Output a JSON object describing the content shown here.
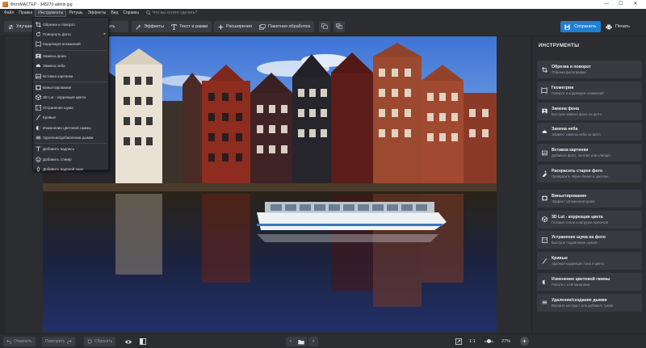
{
  "window": {
    "title": "ФотоМАСТЕР - 348270-admin.jpg",
    "controls": [
      "—",
      "☐",
      "✕"
    ]
  },
  "menubar": {
    "items": [
      "Файл",
      "Правка",
      "Инструменты",
      "Ретушь",
      "Эффекты",
      "Вид",
      "Справка"
    ],
    "active": "Инструменты",
    "search_placeholder": "Что вы хотите сделать?"
  },
  "toolbar": {
    "enhance_label": "Улучшение",
    "partial_label": "ать",
    "effects_label": "Эффекты",
    "text_label": "Текст и рамки",
    "extensions_label": "Расширения",
    "batch_label": "Пакетная обработка",
    "save_label": "Сохранить",
    "print_label": "Печать"
  },
  "tools_menu": {
    "items": [
      {
        "label": "Обрезка и поворот",
        "icon": "crop-icon"
      },
      {
        "label": "Повернуть фото",
        "icon": "rotate-icon",
        "submenu": true
      },
      {
        "label": "Коррекция искажений",
        "icon": "distortion-icon"
      },
      {
        "label": "Замена фона",
        "icon": "background-replace-icon"
      },
      {
        "label": "Замена неба",
        "icon": "sky-replace-icon"
      },
      {
        "label": "Вставка картинки",
        "icon": "insert-image-icon"
      },
      {
        "label": "Виньетирование",
        "icon": "vignette-icon"
      },
      {
        "label": "3D Lut - коррекция цвета",
        "icon": "lut-icon"
      },
      {
        "label": "Устранение шума",
        "icon": "noise-icon"
      },
      {
        "label": "Кривые",
        "icon": "curves-icon"
      },
      {
        "label": "Изменение цветовой гаммы",
        "icon": "color-gamut-icon"
      },
      {
        "label": "Удаление/добавление дымки",
        "icon": "haze-icon"
      },
      {
        "label": "Добавить надпись",
        "icon": "text-icon"
      },
      {
        "label": "Добавить стикер",
        "icon": "sticker-icon"
      },
      {
        "label": "Добавить водяной знак",
        "icon": "watermark-icon"
      }
    ]
  },
  "panel": {
    "title": "ИНСТРУМЕНТЫ",
    "cards": [
      {
        "title": "Обрезка и поворот",
        "desc": "Обрезка фотографии",
        "icon": "crop-icon"
      },
      {
        "title": "Геометрия",
        "desc": "Поворот и коррекция искажений",
        "icon": "geometry-icon"
      },
      {
        "title": "Замена фона",
        "desc": "Быстрая замена фона на фото",
        "icon": "background-replace-icon"
      },
      {
        "title": "Замена неба",
        "desc": "Эффект замены неба на фото",
        "icon": "sky-replace-icon"
      },
      {
        "title": "Вставка картинки",
        "desc": "Добавьте фото, логотип или клипарт",
        "icon": "insert-image-icon"
      },
      {
        "title": "Раскрасить старое фото",
        "desc": "Превратить чёрно-белое в цветное",
        "icon": "colorize-icon"
      },
      {
        "title": "Виньетирование",
        "desc": "Эффект затемнения краёв",
        "icon": "vignette-icon"
      },
      {
        "title": "3D Lut - коррекция цвета",
        "desc": "Готовые стили и загрузка пресетов",
        "icon": "lut-icon"
      },
      {
        "title": "Устранение шума на фото",
        "desc": "Быстрое подавление шумов",
        "icon": "noise-icon"
      },
      {
        "title": "Кривые",
        "desc": "Удобная коррекция тона и цвета",
        "icon": "curves-icon"
      },
      {
        "title": "Изменение цветовой гаммы",
        "desc": "Работа с LAB каналами",
        "icon": "color-gamut-icon"
      },
      {
        "title": "Удаление/создание дымки",
        "desc": "Верните контраст или добавьте туман",
        "icon": "haze-icon"
      }
    ]
  },
  "bottombar": {
    "undo_label": "Отменить",
    "redo_label": "Повторить",
    "reset_label": "Сбросить",
    "zoom_ratio": "1:1",
    "zoom_percent": "27%"
  },
  "colors": {
    "accent": "#1f7fd4",
    "background": "#2b2d31",
    "panel_card": "#373a40"
  }
}
